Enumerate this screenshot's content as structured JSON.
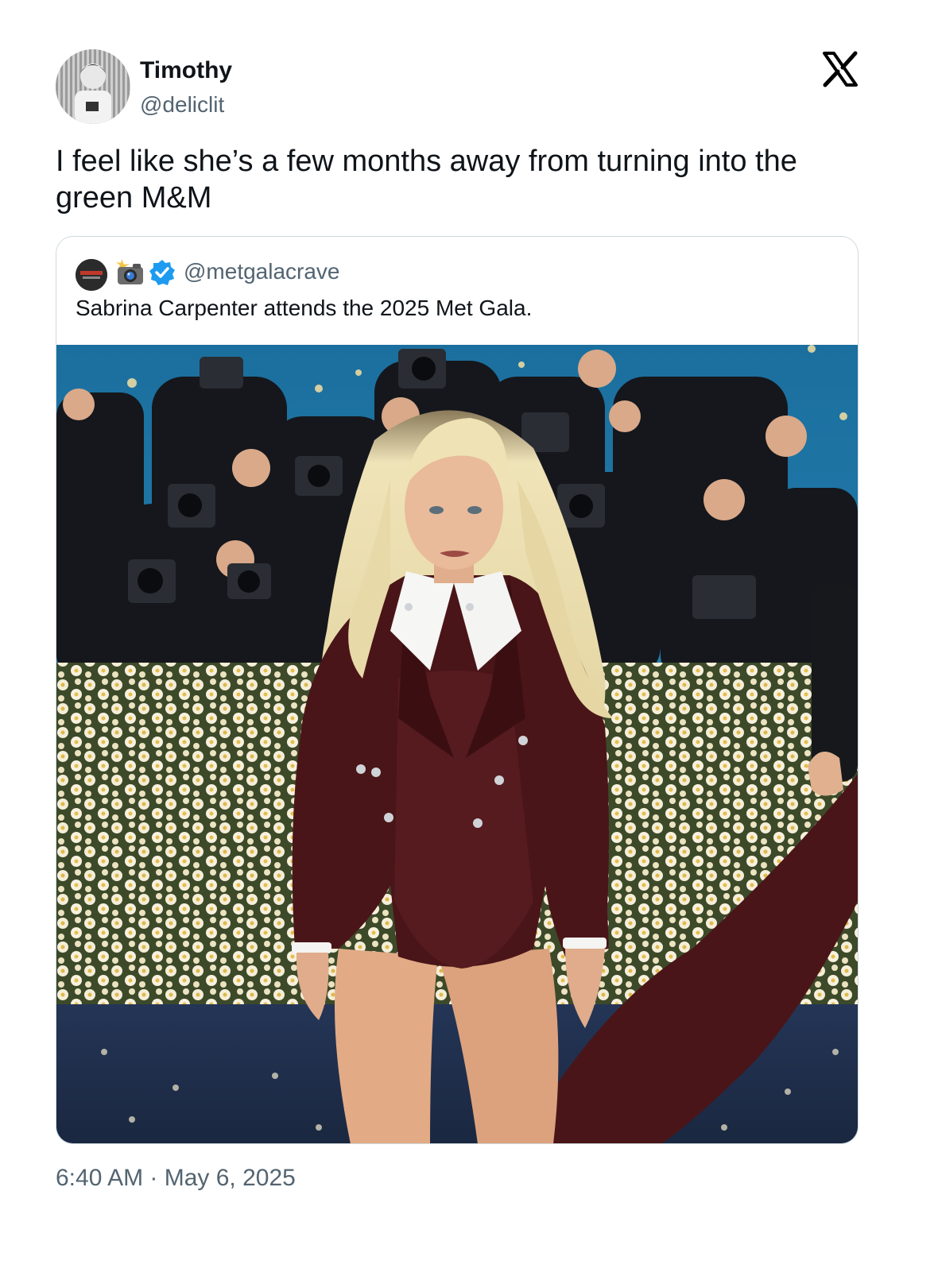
{
  "tweet": {
    "author": {
      "display_name": "Timothy",
      "handle": "@deliclit",
      "avatar_icon": "profile-photo"
    },
    "brand_icon": "x-logo-icon",
    "text": "I feel like she’s a few months away from turning into the green M&M",
    "timestamp": "6:40 AM · May 6, 2025"
  },
  "quote": {
    "handle": "@metgalacrave",
    "verified": true,
    "emoji_icon": "camera-flash-icon",
    "text": "Sabrina Carpenter attends the 2025 Met Gala."
  },
  "colors": {
    "text_primary": "#0f1419",
    "text_secondary": "#536471",
    "border": "#cfd9de",
    "verified_blue": "#1d9bf0",
    "suit_burgundy": "#4a1518",
    "backdrop_blue": "#1f7fb0",
    "carpet_navy": "#1d2b46"
  }
}
